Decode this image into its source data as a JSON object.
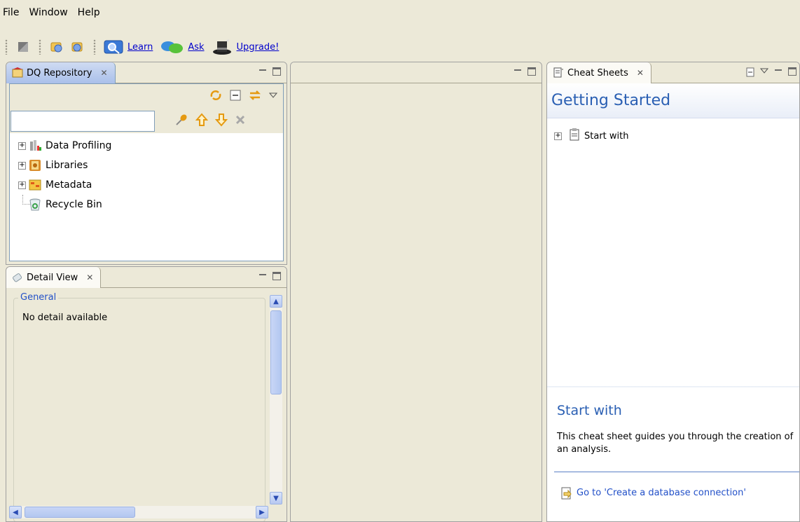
{
  "menubar": {
    "items": [
      "File",
      "Window",
      "Help"
    ]
  },
  "toolbar": {
    "learn_label": "Learn",
    "ask_label": "Ask",
    "upgrade_label": "Upgrade!"
  },
  "repository": {
    "tab_label": "DQ Repository",
    "filter_placeholder": "",
    "tree": [
      {
        "label": "Data Profiling",
        "icon": "data-profiling-icon"
      },
      {
        "label": "Libraries",
        "icon": "libraries-icon"
      },
      {
        "label": "Metadata",
        "icon": "metadata-icon"
      },
      {
        "label": "Recycle Bin",
        "icon": "recycle-bin-icon"
      }
    ]
  },
  "detail": {
    "tab_label": "Detail View",
    "group_title": "General",
    "text": "No detail available"
  },
  "cheatsheets": {
    "tab_label": "Cheat Sheets",
    "title": "Getting Started",
    "step_label": "Start with",
    "section_title": "Start with",
    "description": "This cheat sheet guides you through the creation of an analysis.",
    "action_label": "Go to 'Create a database connection'"
  },
  "colors": {
    "accent": "#2a5fb3",
    "link": "#0000cc",
    "background": "#ece9d8"
  }
}
